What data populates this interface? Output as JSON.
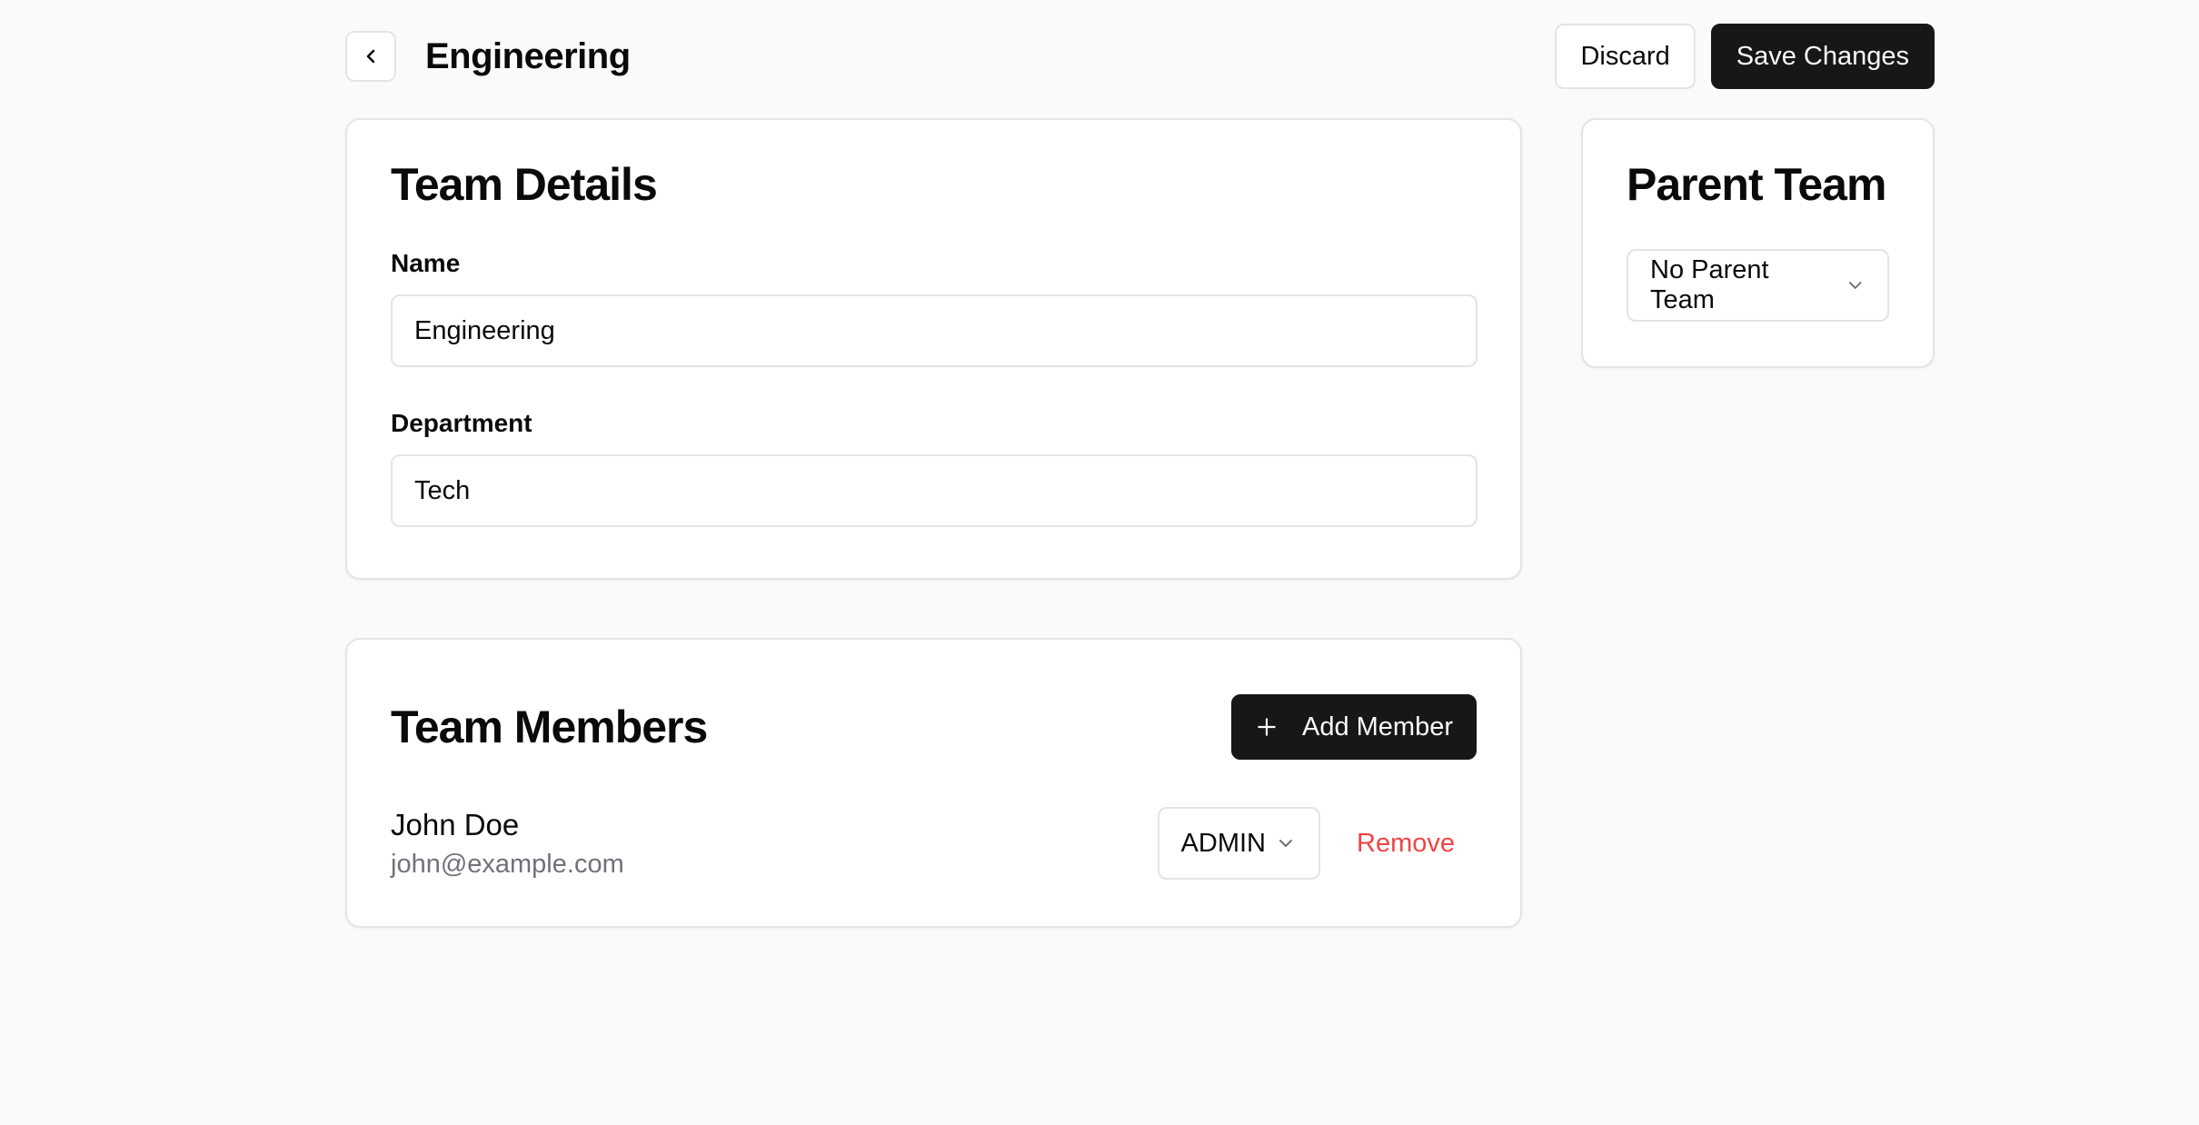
{
  "header": {
    "title": "Engineering",
    "back_icon": "chevron-left-icon",
    "discard_label": "Discard",
    "save_label": "Save Changes"
  },
  "team_details": {
    "title": "Team Details",
    "name_label": "Name",
    "name_value": "Engineering",
    "department_label": "Department",
    "department_value": "Tech"
  },
  "parent_team": {
    "title": "Parent Team",
    "selected": "No Parent Team"
  },
  "team_members": {
    "title": "Team Members",
    "add_label": "Add Member",
    "members": [
      {
        "name": "John Doe",
        "email": "john@example.com",
        "role": "ADMIN",
        "remove_label": "Remove"
      }
    ]
  },
  "colors": {
    "primary": "#171717",
    "background": "#fafafa",
    "border": "#e4e4e7",
    "muted_text": "#71717a",
    "danger": "#ef4444"
  }
}
